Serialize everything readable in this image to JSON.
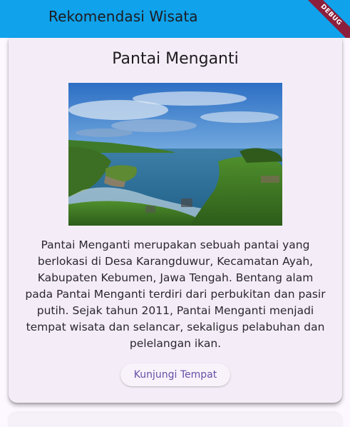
{
  "app_bar": {
    "title": "Rekomendasi Wisata",
    "background": "#10a2ea"
  },
  "debug_banner": {
    "label": "DEBUG"
  },
  "card": {
    "title": "Pantai Menganti",
    "image_icon": "beach-photo",
    "description": "Pantai Menganti merupakan sebuah pantai yang berlokasi di Desa Karangduwur, Kecamatan Ayah, Kabupaten Kebumen, Jawa Tengah. Bentang alam pada Pantai Menganti terdiri dari perbukitan dan pasir putih. Sejak tahun 2011, Pantai Menganti menjadi tempat wisata dan selancar, sekaligus pelabuhan dan pelelangan ikan.",
    "button_label": "Kunjungi Tempat",
    "button_color": "#6750a4"
  }
}
